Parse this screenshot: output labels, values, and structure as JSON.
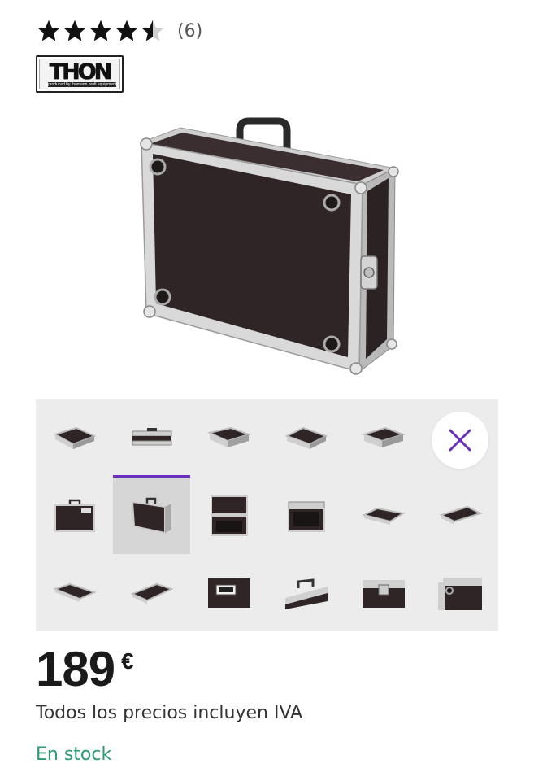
{
  "rating": {
    "value": 4.5,
    "max": 5,
    "count_label": "(6)"
  },
  "brand": {
    "name": "THON",
    "tagline": "produced by thomann profi equipment"
  },
  "gallery": {
    "selected_index": 7,
    "close_icon": "close-icon",
    "accent_color": "#6b2fbf",
    "thumbnails": [
      "case-top-view",
      "case-front-flat",
      "case-angle-flat",
      "case-angle-flat-2",
      "case-angle-flat-3",
      "case-closed-front",
      "case-closed-angle",
      "case-open-interior",
      "case-open-lid",
      "case-tray-angle",
      "case-tray-flat",
      "case-tray-angle-2",
      "case-tray-angle-3",
      "logo-detail",
      "handle-detail",
      "latch-detail",
      "corner-detail"
    ]
  },
  "price": {
    "value": "189",
    "currency": "€"
  },
  "vat_note": "Todos los precios incluyen IVA",
  "stock_status": "En stock",
  "colors": {
    "stock": "#2e9b6f",
    "accent": "#6b2fbf"
  }
}
